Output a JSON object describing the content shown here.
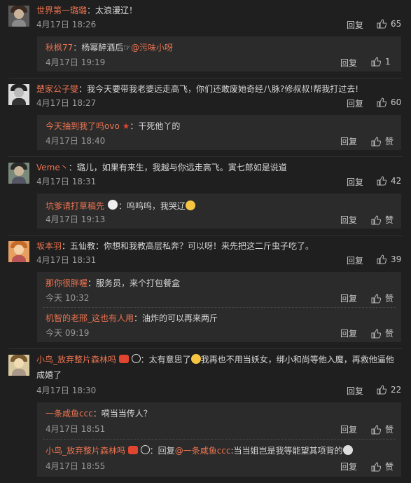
{
  "labels": {
    "reply": "回复",
    "like": "赞"
  },
  "comments": [
    {
      "user": "世界第一璐璐",
      "text": "：太浪漫辽！",
      "time": "4月17日 18:26",
      "likes": "65",
      "replies": [
        {
          "user": "秋枫77",
          "text": "：杨幂醉酒后☞",
          "mention": "@污味小呀",
          "time": "4月17日 19:19",
          "likes": "1"
        }
      ]
    },
    {
      "user": "楚家公子燮",
      "text": "：我今天要带我老婆远走高飞，你们还敢废她奇经八脉?修叔叔!帮我打过去!",
      "time": "4月17日 18:27",
      "likes": "60",
      "replies": [
        {
          "user": "今天抽到我了吗ovo",
          "text": "：干死他丫的",
          "time": "4月17日 18:40",
          "likes": "赞"
        }
      ]
    },
    {
      "user": "Veme丶",
      "text": "：璐儿，如果有来生，我越与你远走高飞。寅七郎如是说道",
      "time": "4月17日 18:31",
      "likes": "42",
      "replies": [
        {
          "user": "坑爹请打草稿先",
          "text": "：呜呜呜，我哭辽",
          "time": "4月17日 19:13",
          "likes": "赞"
        }
      ]
    },
    {
      "user": "坂本羽",
      "text": "：五仙教：你想和我教高层私奔？可以呀！来先把这二斤虫子吃了。",
      "time": "4月17日 18:31",
      "likes": "39",
      "replies": [
        {
          "user": "那你很胖喔",
          "text": "：服务员，来个打包餐盒",
          "time": "今天 10:32",
          "likes": "赞"
        },
        {
          "user": "机智的老邢_这也有人用",
          "text": "：油炸的可以再来两斤",
          "time": "今天 09:19",
          "likes": "赞"
        }
      ]
    },
    {
      "user": "小鸟_放弃整片森林吗",
      "text": "：太有意思了",
      "text2": "我再也不用当妖女，绑小和尚等他入魔，再救他逼他",
      "text3": "成婚了",
      "time": "4月17日 18:30",
      "likes": "22",
      "replies": [
        {
          "user": "一条咸鱼ccc",
          "text": "：嗬当当传人？",
          "time": "4月17日 18:51",
          "likes": "赞"
        },
        {
          "user": "小鸟_放弃整片森林吗",
          "text": "：回复",
          "mention": "@一条咸鱼ccc",
          "text2": ":当当姐岂是我等能望其项背的",
          "time": "4月17日 18:55",
          "likes": "赞"
        }
      ]
    }
  ]
}
